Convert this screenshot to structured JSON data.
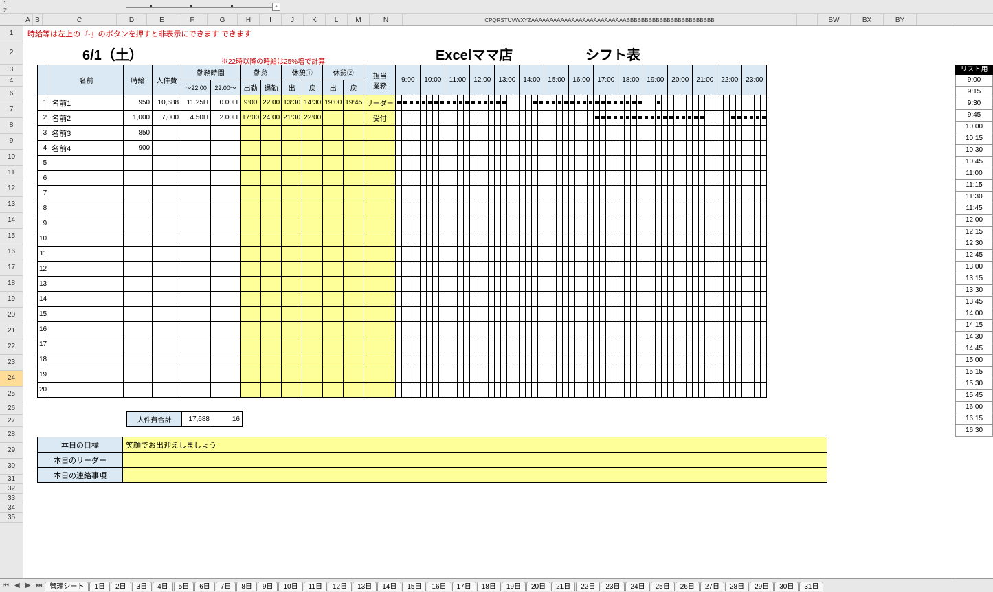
{
  "outline": {
    "levels": [
      "1",
      "2"
    ],
    "collapse_btn": "-"
  },
  "col_letters": [
    "A",
    "B",
    "C",
    "D",
    "E",
    "F",
    "G",
    "H",
    "I",
    "J",
    "K",
    "L",
    "M",
    "N"
  ],
  "col_letters_packed": "CPQRSTUVWXYZAAAAAAAAAAAAAAAAAAAAAAAAAABBBBBBBBBBBBBBBBBBBBBBBB",
  "col_letters_right": [
    "BW",
    "BX",
    "BY"
  ],
  "row_numbers": [
    1,
    2,
    3,
    4,
    6,
    7,
    8,
    9,
    10,
    11,
    12,
    13,
    14,
    15,
    16,
    17,
    18,
    19,
    20,
    21,
    22,
    23,
    24,
    25,
    26,
    27,
    28,
    29,
    30,
    31,
    32,
    33,
    34,
    35
  ],
  "selected_row": 24,
  "notes": {
    "top": "時給等は左上の『-』のボタンを押すと非表示にできます できます",
    "small_red": "※22時以降の時給は25%増で計算"
  },
  "titles": {
    "date": "6/1（土）",
    "store": "Excelママ店",
    "shift": "シフト表"
  },
  "headers": {
    "name": "名前",
    "wage": "時給",
    "labor": "人件費",
    "worktime": "勤務時間",
    "worktime_sub": [
      "～22:00",
      "22:00～"
    ],
    "attendance": "勤怠",
    "attendance_sub": [
      "出勤",
      "退勤"
    ],
    "break1": "休憩①",
    "break1_sub": [
      "出",
      "戻"
    ],
    "break2": "休憩②",
    "break2_sub": [
      "出",
      "戻"
    ],
    "role": "担当\n業務",
    "hours": [
      "9:00",
      "10:00",
      "11:00",
      "12:00",
      "13:00",
      "14:00",
      "15:00",
      "16:00",
      "17:00",
      "18:00",
      "19:00",
      "20:00",
      "21:00",
      "22:00",
      "23:00"
    ]
  },
  "rows": [
    {
      "n": 1,
      "name": "名前1",
      "wage": "950",
      "labor": "10,688",
      "wt1": "11.25H",
      "wt2": "0.00H",
      "in": "9:00",
      "out": "22:00",
      "b1o": "13:30",
      "b1r": "14:30",
      "b2o": "19:00",
      "b2r": "19:45",
      "role": "リーダー",
      "segments": [
        [
          0,
          18
        ],
        [
          22,
          40
        ],
        [
          42,
          43
        ]
      ]
    },
    {
      "n": 2,
      "name": "名前2",
      "wage": "1,000",
      "labor": "7,000",
      "wt1": "4.50H",
      "wt2": "2.00H",
      "in": "17:00",
      "out": "24:00",
      "b1o": "21:30",
      "b1r": "22:00",
      "b2o": "",
      "b2r": "",
      "role": "受付",
      "segments": [
        [
          32,
          50
        ],
        [
          54,
          60
        ]
      ]
    },
    {
      "n": 3,
      "name": "名前3",
      "wage": "850",
      "labor": "",
      "wt1": "",
      "wt2": "",
      "in": "",
      "out": "",
      "b1o": "",
      "b1r": "",
      "b2o": "",
      "b2r": "",
      "role": "",
      "segments": []
    },
    {
      "n": 4,
      "name": "名前4",
      "wage": "900",
      "labor": "",
      "wt1": "",
      "wt2": "",
      "in": "",
      "out": "",
      "b1o": "",
      "b1r": "",
      "b2o": "",
      "b2r": "",
      "role": "",
      "segments": []
    },
    {
      "n": 5
    },
    {
      "n": 6
    },
    {
      "n": 7
    },
    {
      "n": 8
    },
    {
      "n": 9
    },
    {
      "n": 10
    },
    {
      "n": 11
    },
    {
      "n": 12
    },
    {
      "n": 13
    },
    {
      "n": 14
    },
    {
      "n": 15
    },
    {
      "n": 16
    },
    {
      "n": 17
    },
    {
      "n": 18
    },
    {
      "n": 19
    },
    {
      "n": 20
    }
  ],
  "totals": {
    "label": "人件費合計",
    "sum": "17,688",
    "count": "16"
  },
  "footer": [
    {
      "label": "本日の目標",
      "value": "笑顔でお出迎えしましょう"
    },
    {
      "label": "本日のリーダー",
      "value": ""
    },
    {
      "label": "本日の連絡事項",
      "value": ""
    }
  ],
  "list": {
    "header": "リスト用",
    "items": [
      "9:00",
      "9:15",
      "9:30",
      "9:45",
      "10:00",
      "10:15",
      "10:30",
      "10:45",
      "11:00",
      "11:15",
      "11:30",
      "11:45",
      "12:00",
      "12:15",
      "12:30",
      "12:45",
      "13:00",
      "13:15",
      "13:30",
      "13:45",
      "14:00",
      "14:15",
      "14:30",
      "14:45",
      "15:00",
      "15:15",
      "15:30",
      "15:45",
      "16:00",
      "16:15",
      "16:30"
    ]
  },
  "tabs": {
    "nav": [
      "⏮",
      "◀",
      "▶",
      "⏭"
    ],
    "sheets": [
      "管理シート",
      "1日",
      "2日",
      "3日",
      "4日",
      "5日",
      "6日",
      "7日",
      "8日",
      "9日",
      "10日",
      "11日",
      "12日",
      "13日",
      "14日",
      "15日",
      "16日",
      "17日",
      "18日",
      "19日",
      "20日",
      "21日",
      "22日",
      "23日",
      "24日",
      "25日",
      "26日",
      "27日",
      "28日",
      "29日",
      "30日",
      "31日"
    ]
  }
}
